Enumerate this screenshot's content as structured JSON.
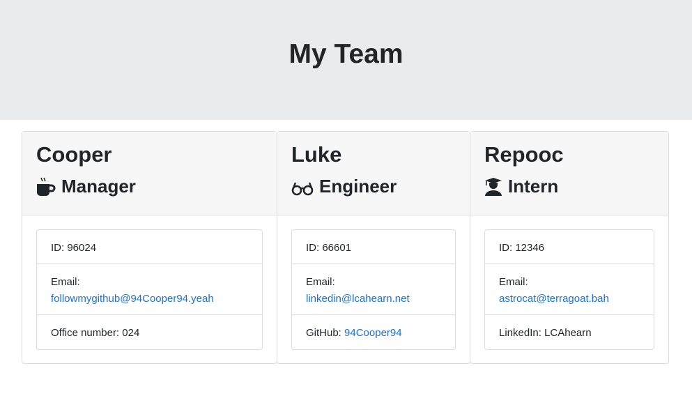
{
  "header": {
    "title": "My Team"
  },
  "members": [
    {
      "name": "Cooper",
      "role": "Manager",
      "icon": "coffee-icon",
      "id_label": "ID:",
      "id": "96024",
      "email_label": "Email:",
      "email": "followmygithub@94Cooper94.yeah",
      "extra_label": "Office number:",
      "extra": "024"
    },
    {
      "name": "Luke",
      "role": "Engineer",
      "icon": "glasses-icon",
      "id_label": "ID:",
      "id": "66601",
      "email_label": "Email:",
      "email": "linkedin@lcahearn.net",
      "extra_label": "GitHub:",
      "extra": "94Cooper94"
    },
    {
      "name": "Repooc",
      "role": "Intern",
      "icon": "user-graduate-icon",
      "id_label": "ID:",
      "id": "12346",
      "email_label": "Email:",
      "email": "astrocat@terragoat.bah",
      "extra_label": "LinkedIn:",
      "extra": "LCAhearn"
    }
  ]
}
